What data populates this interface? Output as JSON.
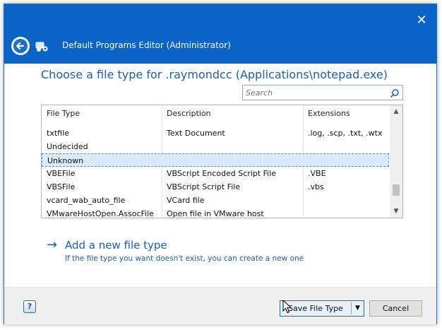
{
  "window": {
    "title": "Default Programs Editor (Administrator)",
    "close_glyph": "✕",
    "back_icon": "back-arrow-icon",
    "app_icon": "app-icon",
    "accent_color": "#0a63c7"
  },
  "heading": "Choose a file type for .raymondcc (Applications\\notepad.exe)",
  "search": {
    "placeholder": "Search",
    "value": "",
    "icon": "search-icon"
  },
  "table": {
    "columns": [
      "File Type",
      "Description",
      "Extensions"
    ],
    "rows": [
      {
        "type": "txtfile",
        "description": "Text Document",
        "extensions": ".log, .scp, .txt, .wtx"
      },
      {
        "type": "Undecided",
        "description": "",
        "extensions": ""
      },
      {
        "type": "Unknown",
        "description": "",
        "extensions": "",
        "selected": true
      },
      {
        "type": "VBEFile",
        "description": "VBScript Encoded Script File",
        "extensions": ".VBE"
      },
      {
        "type": "VBSFile",
        "description": "VBScript Script File",
        "extensions": ".vbs"
      },
      {
        "type": "vcard_wab_auto_file",
        "description": "VCard file",
        "extensions": ""
      },
      {
        "type": "VMwareHostOpen.AssocFile",
        "description": "Open file in VMware host",
        "extensions": ""
      }
    ]
  },
  "add_new": {
    "arrow": "→",
    "title": "Add a new file type",
    "description": "If the file type you want doesn't exist, you can create a new one"
  },
  "footer": {
    "help_label": "?",
    "save_label": "Save File Type",
    "dropdown_glyph": "▼",
    "cancel_label": "Cancel"
  }
}
